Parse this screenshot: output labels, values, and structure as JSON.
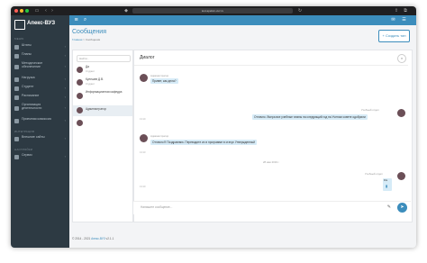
{
  "browser": {
    "url": "test.apelsin-vuz.ru",
    "colors": {
      "close": "#ff5f57",
      "minimize": "#febc2e",
      "maximize": "#28c840"
    }
  },
  "app": {
    "logo_text": "Апекс-ВУЗ",
    "accent": "#3c8dbc"
  },
  "sidebar": {
    "section_main": "МЕНЮ",
    "items": [
      {
        "label": "Штаты",
        "icon": "staff-icon"
      },
      {
        "label": "Планы",
        "icon": "plans-icon"
      },
      {
        "label": "Методическое обеспечение",
        "icon": "book-icon"
      },
      {
        "label": "Нагрузка",
        "icon": "workload-icon"
      },
      {
        "label": "Студент",
        "icon": "student-icon"
      },
      {
        "label": "Расписание",
        "icon": "calendar-icon"
      },
      {
        "label": "Организация деятельности",
        "icon": "org-icon"
      },
      {
        "label": "Приемная комиссия",
        "icon": "admission-icon"
      }
    ],
    "section_integration": "ИНТЕГРАЦИЯ",
    "integration_items": [
      {
        "label": "Внешние сайты",
        "icon": "globe-icon"
      }
    ],
    "section_settings": "НАСТРОЙКИ",
    "settings_items": [
      {
        "label": "Сервис",
        "icon": "wrench-icon"
      }
    ]
  },
  "page": {
    "title": "Сообщения",
    "breadcrumb_home": "Главная",
    "breadcrumb_sep": " > ",
    "breadcrumb_current": "Сообщения",
    "new_button": "+ Создать тип"
  },
  "contacts": {
    "search_placeholder": "Найти...",
    "items": [
      {
        "name": "Да",
        "sub": "Студент",
        "selected": false
      },
      {
        "name": "Кулешев Д.В.",
        "sub": "Студент",
        "selected": false
      },
      {
        "name": "Информационная кафедра",
        "sub": "",
        "selected": false
      },
      {
        "name": "Администратор",
        "sub": "",
        "selected": true
      },
      {
        "name": "",
        "sub": "",
        "selected": false
      }
    ]
  },
  "chat": {
    "header": "Диалог",
    "messages": [
      {
        "author": "Администратор",
        "text": "Привет, как дела?",
        "time": "13:10",
        "side": "left"
      },
      {
        "author": "Учебный отдел",
        "text": "Отлично. Вчера все учебные планы на следующий год на Ученом совете одобрили",
        "time": "13:10",
        "side": "right"
      },
      {
        "author": "Администратор",
        "text": "Отлично!!! Поздравляю. Переводите их в программе в статус Утвержденный",
        "time": "13:13",
        "side": "left"
      }
    ],
    "date_divider": "28 мая 2019 г.",
    "file_message": {
      "author": "Учебный отдел",
      "label": "File",
      "time": "13:10",
      "side": "right"
    },
    "compose_placeholder": "Напишите сообщение..."
  },
  "footer": {
    "copyright": "© 2014 - 2021",
    "product": "Апекс-ВУЗ",
    "version": "v2.1.1"
  }
}
